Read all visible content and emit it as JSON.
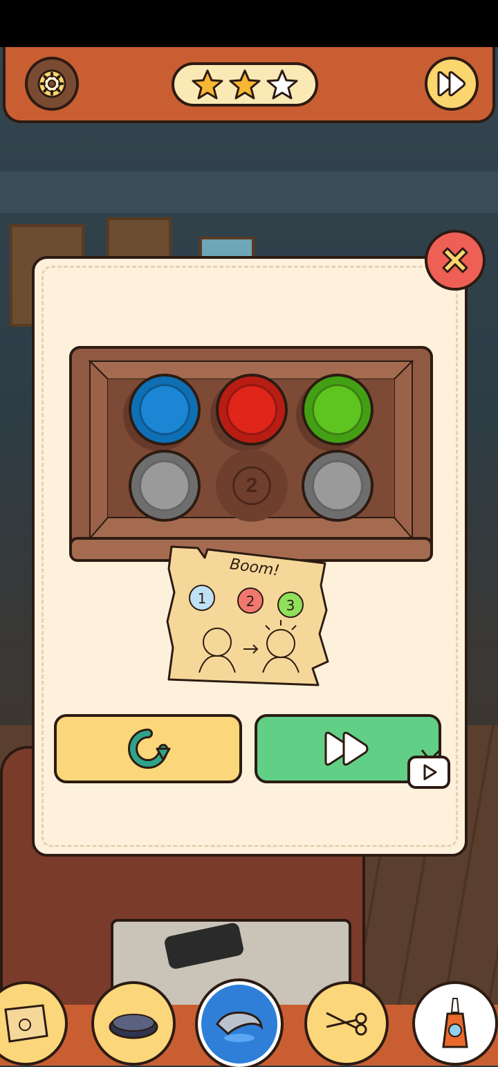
{
  "game": {
    "stars_earned": 2,
    "stars_total": 3
  },
  "top_bar": {
    "settings_icon": "gear-icon",
    "skip_icon": "fast-forward-icon"
  },
  "puzzle": {
    "slot_rows": [
      [
        {
          "state": "pressed-color",
          "color": "#1a86d4"
        },
        {
          "state": "pressed-color",
          "color": "#e0251b"
        },
        {
          "state": "pressed-color",
          "color": "#5ec41f"
        }
      ],
      [
        {
          "state": "unpressed",
          "color": "#9a9a9a"
        },
        {
          "state": "empty",
          "label": "2"
        },
        {
          "state": "unpressed",
          "color": "#9a9a9a"
        }
      ]
    ],
    "empty_slot_label": "2"
  },
  "hint_note": {
    "text": "Boom!",
    "circle_labels": [
      "1",
      "2",
      "3"
    ],
    "circle_colors": [
      "#3a9bd8",
      "#e0352b",
      "#5ec41f"
    ]
  },
  "dialog": {
    "close_icon": "close-icon",
    "retry_icon": "refresh-icon",
    "skip_icon": "fast-forward-icon",
    "ad_icon": "tv-play-icon"
  },
  "inventory": [
    {
      "name": "note-item"
    },
    {
      "name": "robot-vacuum-item"
    },
    {
      "name": "shrimp-item",
      "selected": true
    },
    {
      "name": "scissors-item"
    },
    {
      "name": "glue-bottle-item"
    }
  ],
  "colors": {
    "accent": "#c95e33",
    "outline": "#2c1b12",
    "dialog_bg": "#fdf1dc",
    "retry": "#fbd67a",
    "skip": "#62cf86"
  }
}
